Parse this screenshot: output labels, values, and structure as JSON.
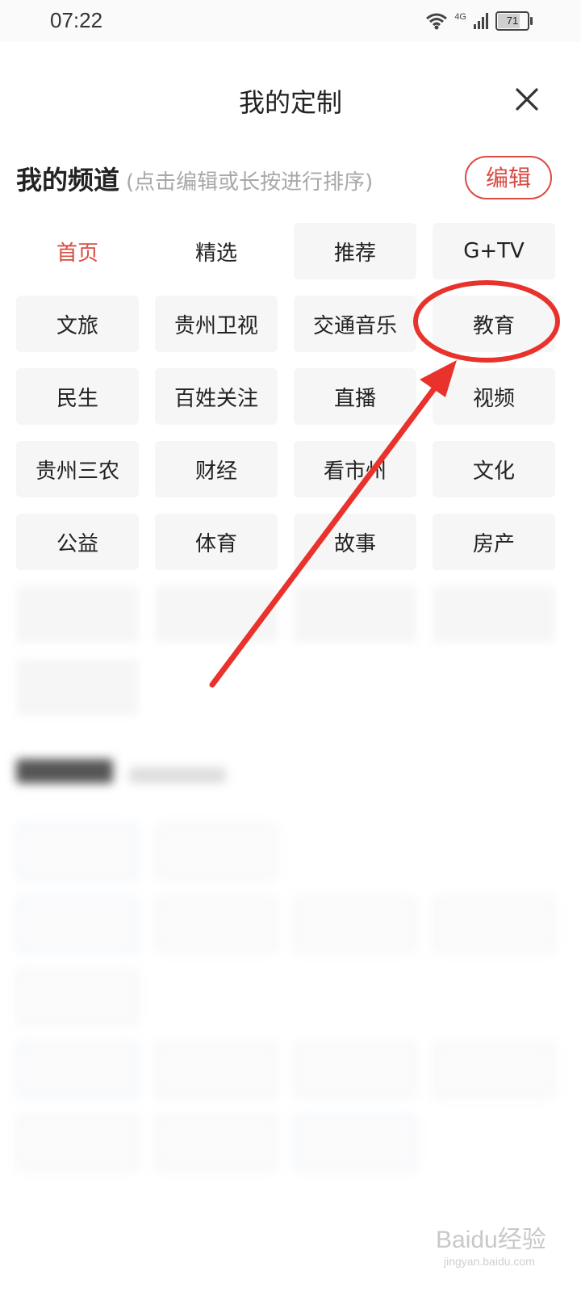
{
  "status_bar": {
    "time": "07:22",
    "network": "4G",
    "battery": "71",
    "battery_level_percent": 71
  },
  "header": {
    "title": "我的定制",
    "close_icon": "close-icon"
  },
  "my_channels": {
    "title": "我的频道",
    "hint": "(点击编辑或长按进行排序)",
    "edit_label": "编辑",
    "items": [
      {
        "label": "首页"
      },
      {
        "label": "精选"
      },
      {
        "label": "推荐"
      },
      {
        "label": "G+TV"
      },
      {
        "label": "文旅"
      },
      {
        "label": "贵州卫视"
      },
      {
        "label": "交通音乐"
      },
      {
        "label": "教育"
      },
      {
        "label": "民生"
      },
      {
        "label": "百姓关注"
      },
      {
        "label": "直播"
      },
      {
        "label": "视频"
      },
      {
        "label": "贵州三农"
      },
      {
        "label": "财经"
      },
      {
        "label": "看市州"
      },
      {
        "label": "文化"
      },
      {
        "label": "公益"
      },
      {
        "label": "体育"
      },
      {
        "label": "故事"
      },
      {
        "label": "房产"
      }
    ]
  },
  "watermark": {
    "brand": "Baidu经验",
    "url": "jingyan.baidu.com"
  },
  "colors": {
    "accent": "#d94b44",
    "annotation": "#e8322b",
    "chip_background": "#f6f6f6"
  }
}
